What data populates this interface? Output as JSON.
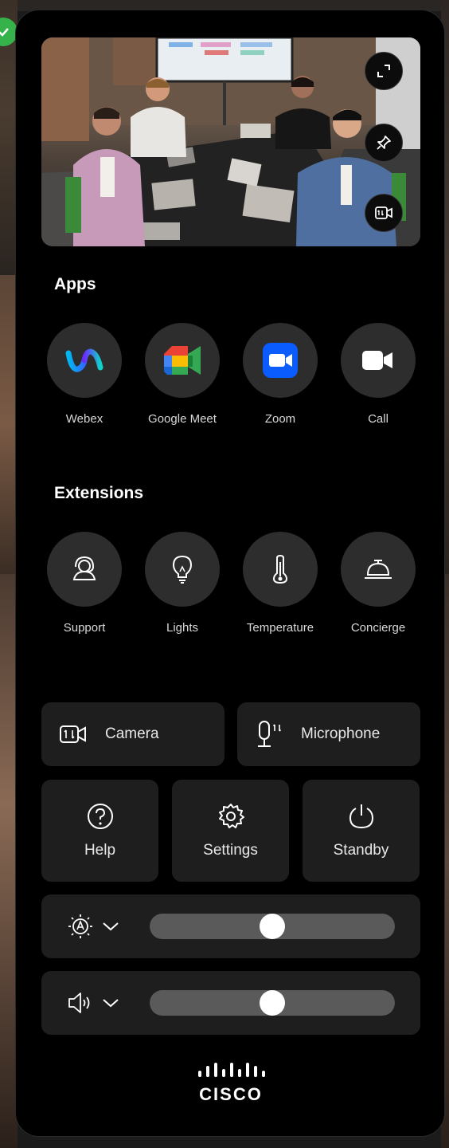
{
  "apps": {
    "title": "Apps",
    "items": [
      {
        "label": "Webex",
        "icon": "webex-icon"
      },
      {
        "label": "Google Meet",
        "icon": "google-meet-icon"
      },
      {
        "label": "Zoom",
        "icon": "zoom-icon"
      },
      {
        "label": "Call",
        "icon": "call-icon"
      }
    ]
  },
  "extensions": {
    "title": "Extensions",
    "items": [
      {
        "label": "Support",
        "icon": "support-icon"
      },
      {
        "label": "Lights",
        "icon": "lightbulb-icon"
      },
      {
        "label": "Temperature",
        "icon": "thermometer-icon"
      },
      {
        "label": "Concierge",
        "icon": "concierge-bell-icon"
      }
    ]
  },
  "controls": {
    "camera_label": "Camera",
    "microphone_label": "Microphone",
    "help_label": "Help",
    "settings_label": "Settings",
    "standby_label": "Standby"
  },
  "sliders": {
    "brightness_value": 0.5,
    "volume_value": 0.5
  },
  "brand": {
    "logo_text": "CISCO"
  },
  "colors": {
    "panel": "#000000",
    "button_bg": "#1e1e1e",
    "circle_bg": "#2d2d2d",
    "zoom_blue": "#0b5cff",
    "status_green": "#36b24a"
  }
}
